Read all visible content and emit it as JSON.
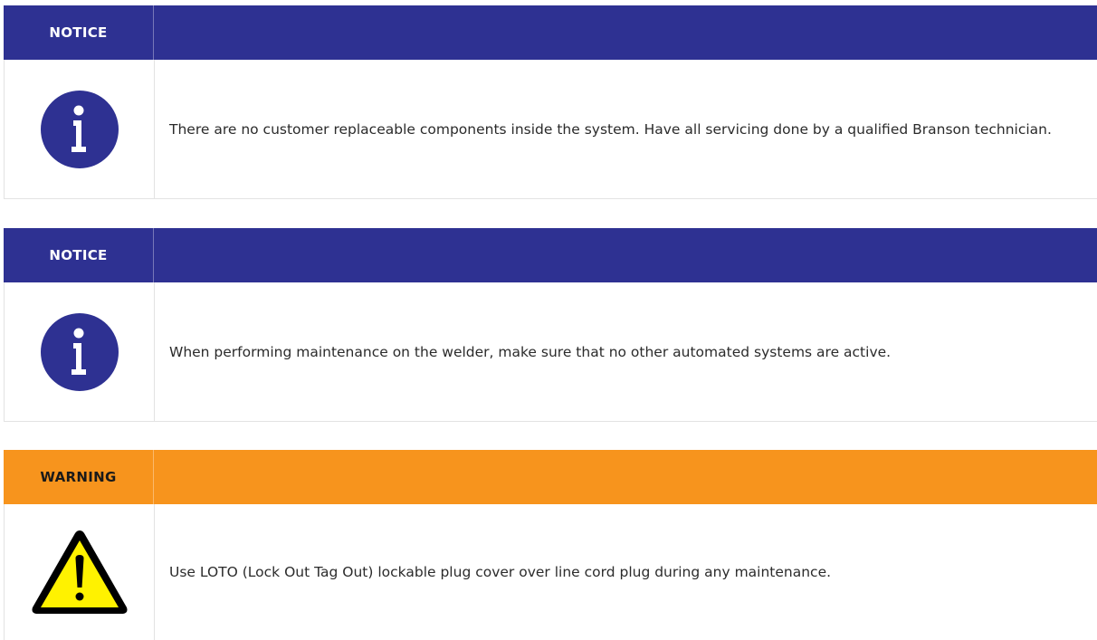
{
  "colors": {
    "notice_header": "#2e3192",
    "warning_header": "#f7941d",
    "notice_label_text": "#ffffff",
    "warning_label_text": "#1a1a1a",
    "info_icon_fill": "#2e3192",
    "warning_icon_fill": "#fff200"
  },
  "blocks": [
    {
      "type": "notice",
      "label": "NOTICE",
      "icon": "info-icon",
      "message": "There are no customer replaceable components inside the system. Have all servicing done by a qualified Branson technician."
    },
    {
      "type": "notice",
      "label": "NOTICE",
      "icon": "info-icon",
      "message": "When performing maintenance on the welder, make sure that no other automated systems are active."
    },
    {
      "type": "warning",
      "label": "WARNING",
      "icon": "warning-triangle-icon",
      "message": "Use LOTO (Lock Out Tag Out) lockable plug cover over line cord plug during any maintenance."
    }
  ]
}
